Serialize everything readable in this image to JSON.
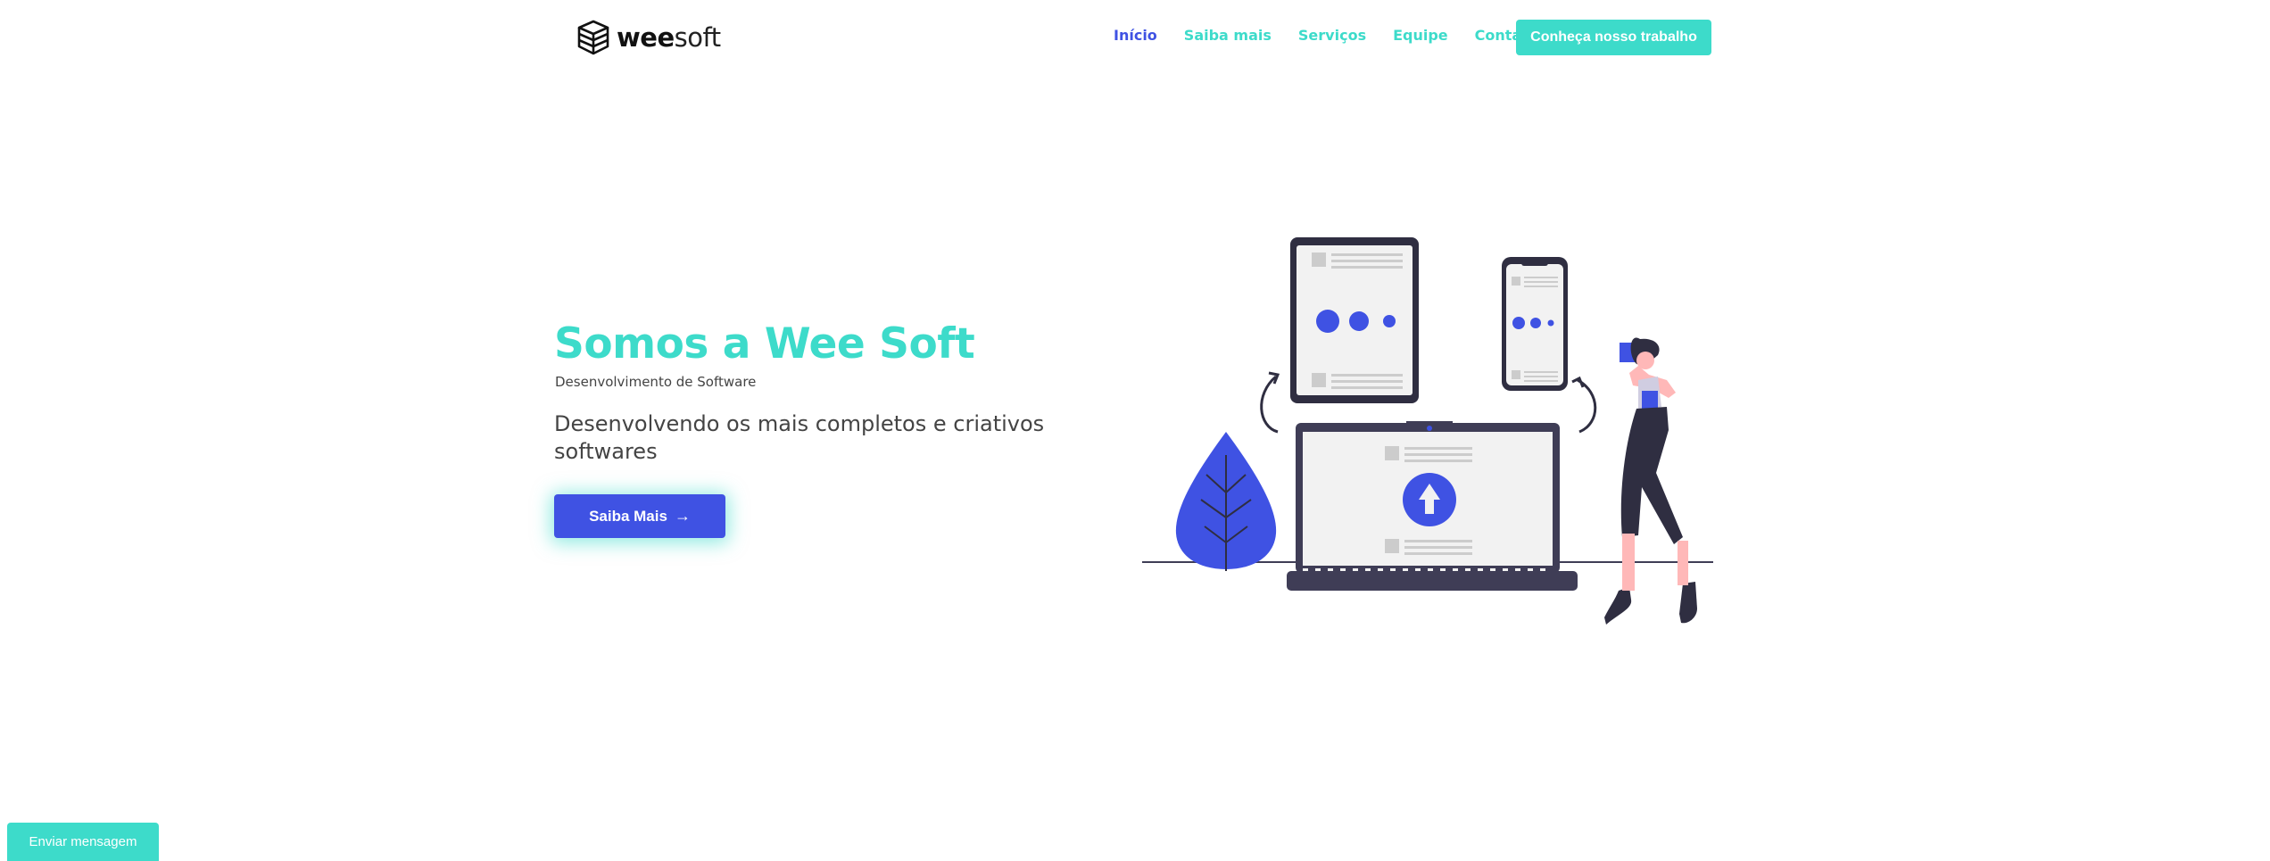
{
  "brand": {
    "name_bold": "wee",
    "name_light": "soft"
  },
  "nav": {
    "items": [
      {
        "label": "Início",
        "active": true
      },
      {
        "label": "Saiba mais",
        "active": false
      },
      {
        "label": "Serviços",
        "active": false
      },
      {
        "label": "Equipe",
        "active": false
      },
      {
        "label": "Contato",
        "active": false
      }
    ],
    "cta_label": "Conheça nosso trabalho"
  },
  "hero": {
    "title": "Somos a Wee Soft",
    "subtitle": "Desenvolvimento de Software",
    "description": "Desenvolvendo os mais completos e criativos softwares",
    "button_label": "Saiba Mais",
    "button_arrow": "→"
  },
  "chat": {
    "button_label": "Enviar mensagem"
  },
  "colors": {
    "accent_teal": "#3ddbca",
    "accent_blue": "#3f52e3",
    "dark": "#2f2e41",
    "light_gray": "#f2f2f2"
  },
  "icons": {
    "logo": "stacked-boxes-logo-icon",
    "upload": "upload-arrow-icon",
    "hero_arrow": "arrow-right-icon"
  }
}
